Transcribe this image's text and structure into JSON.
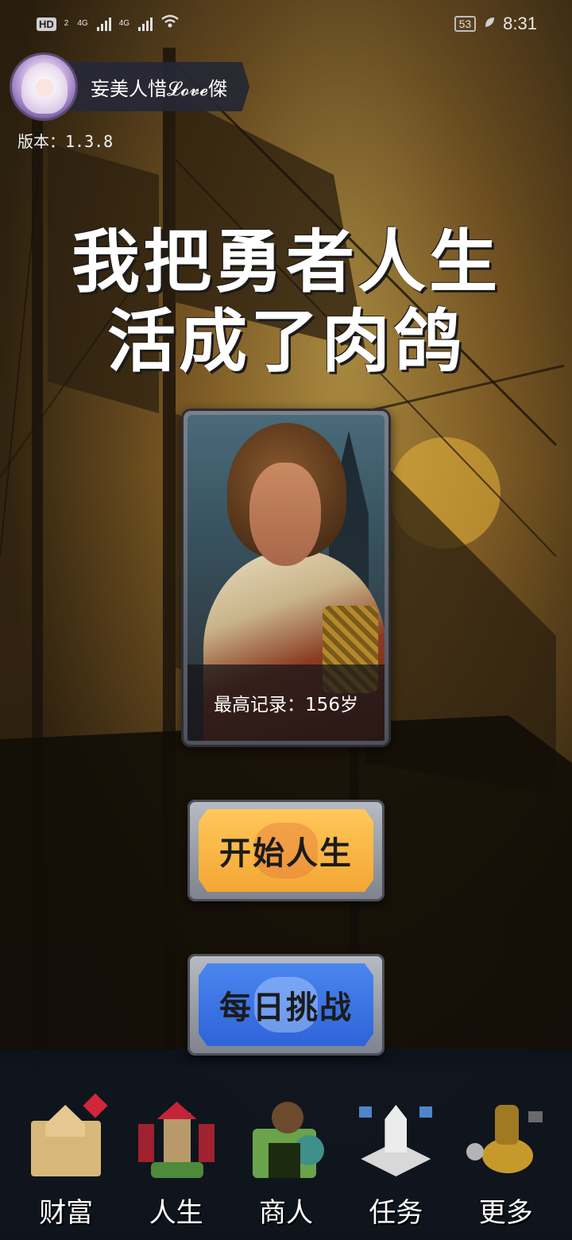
{
  "status_bar": {
    "hd_label": "HD",
    "sim1_label": "2",
    "net1": "4G",
    "net2": "4G",
    "battery": "53",
    "time": "8:31"
  },
  "profile": {
    "username": "妄美人惜𝓛𝓸𝓿𝓮傑",
    "version": "版本：1.3.8"
  },
  "title": {
    "line1": "我把勇者人生",
    "line2": "活成了肉鸽"
  },
  "hero_card": {
    "record_label": "最高记录：156岁"
  },
  "buttons": {
    "start": "开始人生",
    "daily": "每日挑战"
  },
  "colors": {
    "start_button": "#f3a634",
    "daily_button": "#2f63d8",
    "card_frame": "#7c818c"
  },
  "nav": {
    "items": [
      {
        "label": "财富",
        "icon": "castle-icon"
      },
      {
        "label": "人生",
        "icon": "tower-icon"
      },
      {
        "label": "商人",
        "icon": "shop-icon"
      },
      {
        "label": "任务",
        "icon": "monument-icon"
      },
      {
        "label": "更多",
        "icon": "machine-icon"
      }
    ]
  }
}
